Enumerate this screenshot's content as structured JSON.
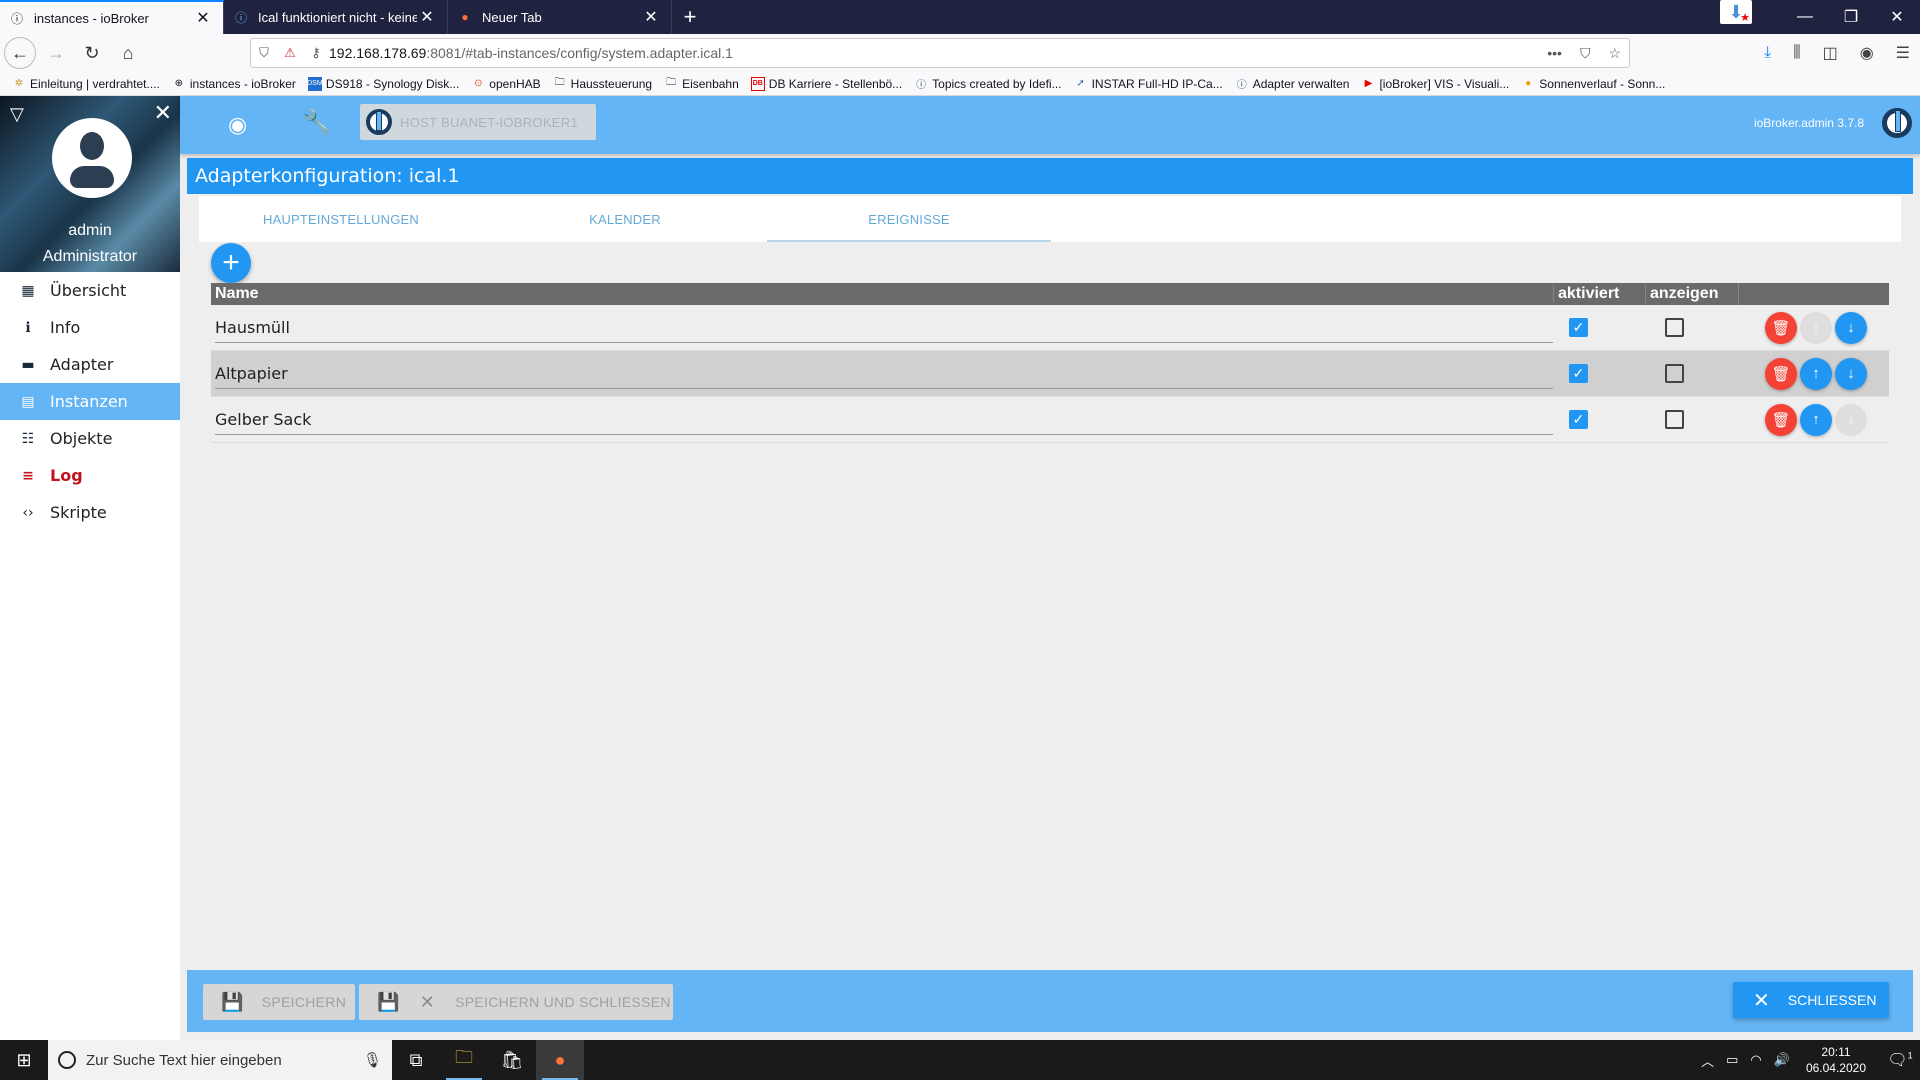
{
  "browser": {
    "tabs": [
      {
        "label": "instances - ioBroker",
        "icon": "iobroker-icon",
        "active": true
      },
      {
        "label": "Ical funktioniert nicht - keine E",
        "icon": "iobroker-icon",
        "active": false
      },
      {
        "label": "Neuer Tab",
        "icon": "firefox-icon",
        "active": false
      }
    ],
    "new_tab": "+",
    "url_host": "192.168.178.69",
    "url_rest": ":8081/#tab-instances/config/system.adapter.ical.1",
    "bookmarks": [
      {
        "label": "Einleitung | verdrahtet....",
        "icon": "gear-icon"
      },
      {
        "label": "instances - ioBroker",
        "icon": "globe-icon"
      },
      {
        "label": "DS918 - Synology Disk...",
        "icon": "dsm-icon"
      },
      {
        "label": "openHAB",
        "icon": "openhab-icon"
      },
      {
        "label": "Haussteuerung",
        "icon": "folder-icon"
      },
      {
        "label": "Eisenbahn",
        "icon": "folder-icon"
      },
      {
        "label": "DB Karriere - Stellenbö...",
        "icon": "db-icon"
      },
      {
        "label": "Topics created by Idefi...",
        "icon": "iobroker-icon"
      },
      {
        "label": "INSTAR Full-HD IP-Ca...",
        "icon": "instar-icon"
      },
      {
        "label": "Adapter verwalten",
        "icon": "iobroker-icon"
      },
      {
        "label": "[ioBroker] VIS - Visuali...",
        "icon": "youtube-icon"
      },
      {
        "label": "Sonnenverlauf - Sonn...",
        "icon": "sun-icon"
      }
    ]
  },
  "sidebar": {
    "user_name": "admin",
    "user_role": "Administrator",
    "items": [
      {
        "label": "Übersicht",
        "icon": "grid-icon",
        "active": false
      },
      {
        "label": "Info",
        "icon": "info-icon",
        "active": false
      },
      {
        "label": "Adapter",
        "icon": "store-icon",
        "active": false
      },
      {
        "label": "Instanzen",
        "icon": "instances-icon",
        "active": true
      },
      {
        "label": "Objekte",
        "icon": "list-icon",
        "active": false
      },
      {
        "label": "Log",
        "icon": "log-icon",
        "active": false
      },
      {
        "label": "Skripte",
        "icon": "code-icon",
        "active": false
      }
    ]
  },
  "topbar": {
    "host_label": "HOST BUANET-IOBROKER1",
    "version": "ioBroker.admin 3.7.8"
  },
  "config": {
    "title": "Adapterkonfiguration: ical.1",
    "tabs": [
      {
        "label": "HAUPTEINSTELLUNGEN",
        "active": false
      },
      {
        "label": "KALENDER",
        "active": false
      },
      {
        "label": "EREIGNISSE",
        "active": true
      }
    ],
    "add_label": "+",
    "table": {
      "columns": [
        "Name",
        "aktiviert",
        "anzeigen"
      ],
      "rows": [
        {
          "name": "Hausmüll",
          "aktiviert": true,
          "anzeigen": false,
          "up_enabled": false,
          "down_enabled": true
        },
        {
          "name": "Altpapier",
          "aktiviert": true,
          "anzeigen": false,
          "up_enabled": true,
          "down_enabled": true
        },
        {
          "name": "Gelber Sack",
          "aktiviert": true,
          "anzeigen": false,
          "up_enabled": true,
          "down_enabled": false
        }
      ]
    }
  },
  "footer": {
    "save_label": "SPEICHERN",
    "save_close_label": "SPEICHERN UND SCHLIESSEN",
    "close_label": "SCHLIESSEN"
  },
  "taskbar": {
    "search_placeholder": "Zur Suche Text hier eingeben",
    "time": "20:11",
    "date": "06.04.2020",
    "notification_count": "1"
  }
}
